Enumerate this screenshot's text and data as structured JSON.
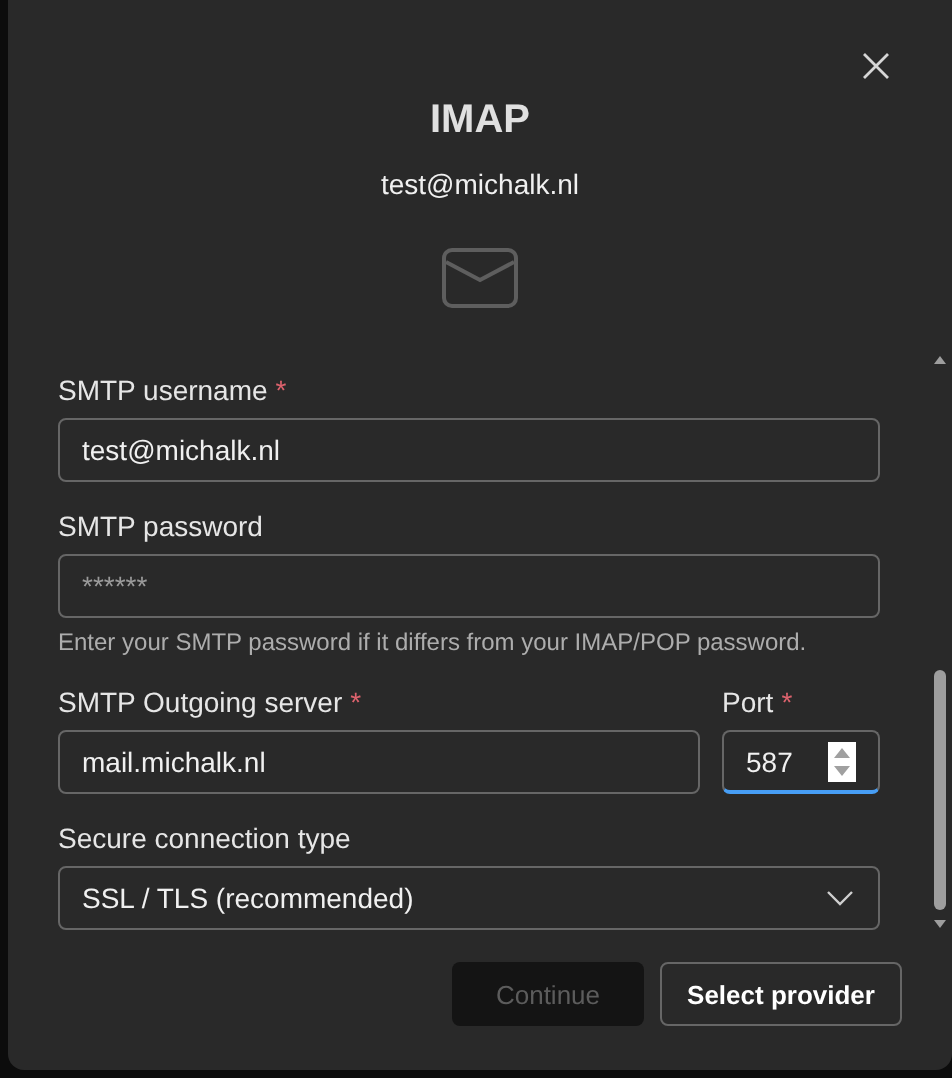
{
  "dialog": {
    "title": "IMAP",
    "subtitle": "test@michalk.nl"
  },
  "required_mark": "*",
  "rows": [
    {
      "fields": [
        {
          "kind": "text",
          "label": "SMTP username",
          "required": true,
          "value": "test@michalk.nl",
          "focused": false
        }
      ]
    },
    {
      "fields": [
        {
          "kind": "password",
          "label": "SMTP password",
          "required": false,
          "placeholder": "******",
          "focused": false,
          "help": "Enter your SMTP password if it differs from your IMAP/POP password."
        }
      ]
    },
    {
      "fields": [
        {
          "kind": "text",
          "label": "SMTP Outgoing server",
          "required": true,
          "value": "mail.michalk.nl",
          "focused": false
        },
        {
          "kind": "number",
          "label": "Port",
          "required": true,
          "value": "587",
          "focused": true
        }
      ]
    },
    {
      "fields": [
        {
          "kind": "select",
          "label": "Secure connection type",
          "required": false,
          "value": "SSL / TLS (recommended)",
          "focused": false
        }
      ]
    }
  ],
  "buttons": [
    {
      "label": "Continue",
      "disabled": true
    },
    {
      "label": "Select provider",
      "disabled": false
    }
  ]
}
